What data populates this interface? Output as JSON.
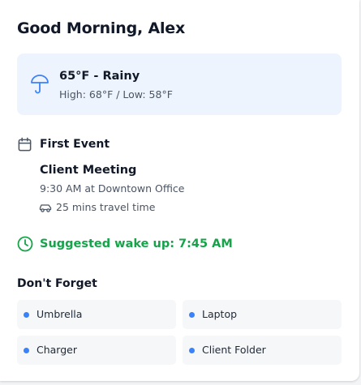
{
  "greeting": "Good Morning, Alex",
  "weather": {
    "icon": "umbrella-icon",
    "summary": "65°F - Rainy",
    "high_low": "High: 68°F / Low: 58°F"
  },
  "first_event": {
    "icon": "calendar-icon",
    "heading": "First Event",
    "title": "Client Meeting",
    "detail": "9:30 AM at Downtown Office",
    "travel_icon": "car-icon",
    "travel": "25 mins travel time"
  },
  "wake_up": {
    "icon": "clock-icon",
    "text": "Suggested wake up: 7:45 AM"
  },
  "reminders": {
    "heading": "Don't Forget",
    "items": [
      {
        "label": "Umbrella"
      },
      {
        "label": "Laptop"
      },
      {
        "label": "Charger"
      },
      {
        "label": "Client Folder"
      }
    ]
  },
  "colors": {
    "accent_blue": "#3b82f6",
    "success_green": "#16a34a",
    "weather_bg": "#eef4fe"
  }
}
